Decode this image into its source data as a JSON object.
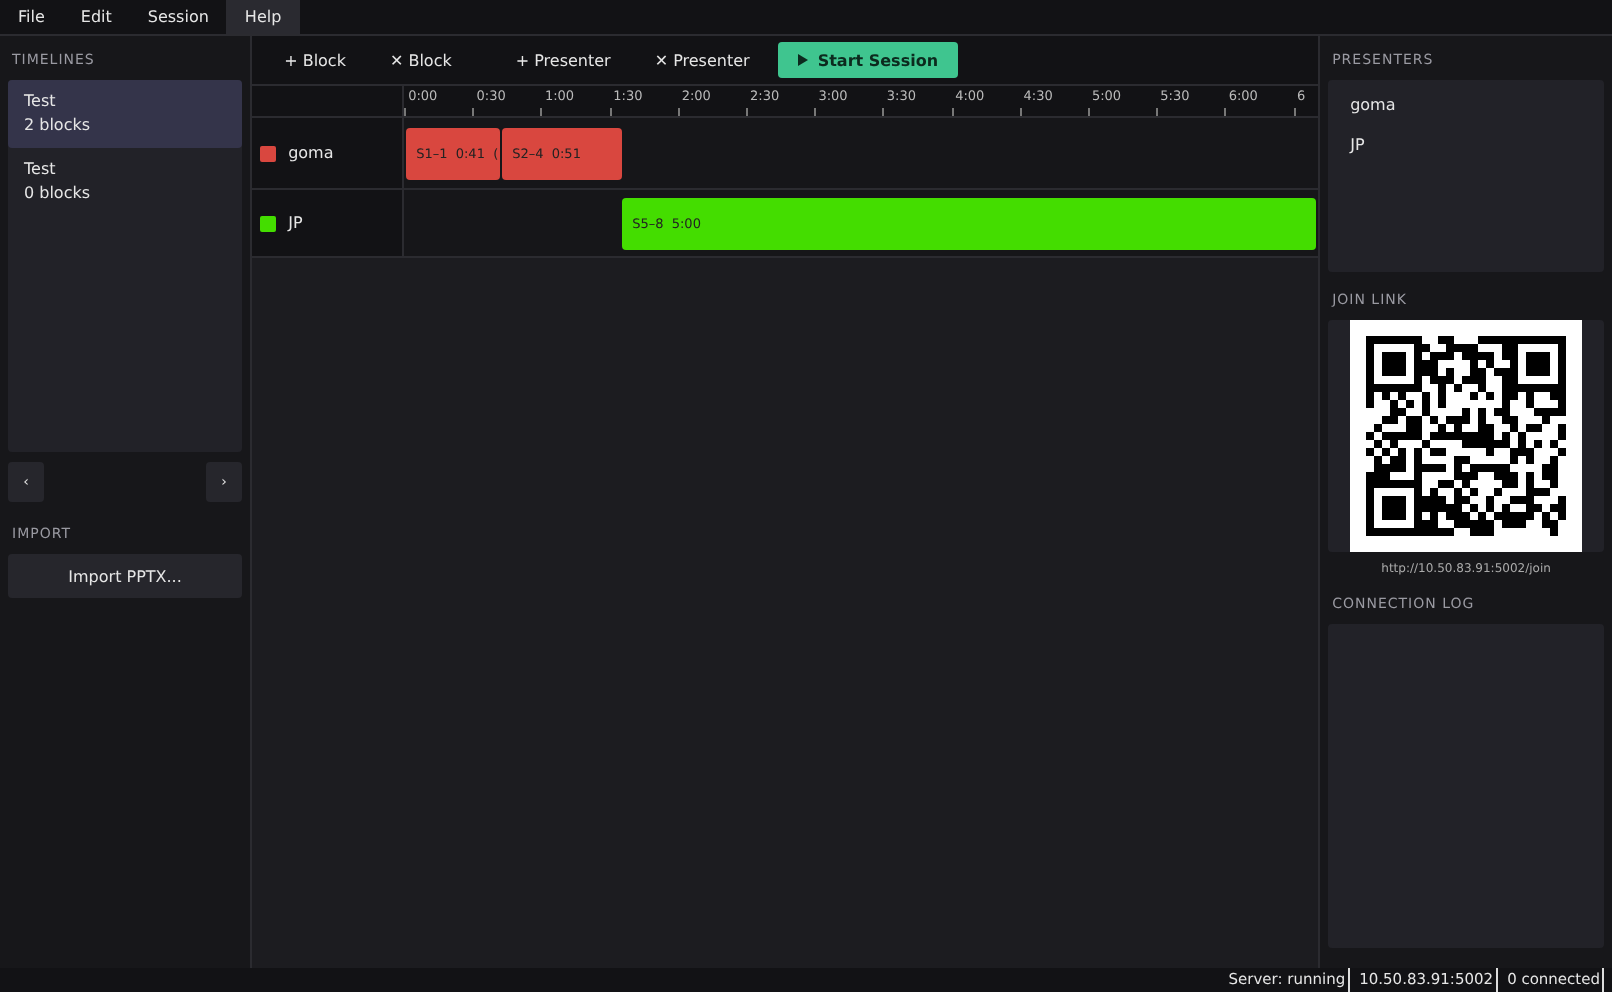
{
  "menu": [
    {
      "label": "File",
      "selected": false
    },
    {
      "label": "Edit",
      "selected": false
    },
    {
      "label": "Session",
      "selected": false
    },
    {
      "label": "Help",
      "selected": true
    }
  ],
  "timelines": {
    "title": "TIMELINES",
    "items": [
      {
        "name": "Test",
        "count": "2 blocks",
        "selected": true
      },
      {
        "name": "Test",
        "count": "0 blocks",
        "selected": false
      }
    ],
    "prev": "‹",
    "next": "›"
  },
  "import": {
    "title": "IMPORT",
    "button": "Import PPTX..."
  },
  "toolbar": {
    "buttons": [
      "+ Block",
      "✕ Block",
      "+ Presenter",
      "✕ Presenter"
    ],
    "start": "Start Session"
  },
  "ticks": [
    "0:00",
    "0:30",
    "1:00",
    "1:30",
    "2:00",
    "2:30",
    "3:00",
    "3:30",
    "4:00",
    "4:30",
    "5:00",
    "5:30",
    "6:00",
    "6"
  ],
  "tracks": [
    {
      "name": "goma",
      "color": "#d9473f",
      "blocks": [
        {
          "label": "S1–1  0:41  ("
        },
        {
          "label": "S2–4  0:51"
        }
      ]
    },
    {
      "name": "JP",
      "color": "#44dd00",
      "blocks": [
        {
          "label": "S5–8  5:00"
        }
      ]
    }
  ],
  "presenters": {
    "title": "PRESENTERS",
    "items": [
      "goma",
      "JP"
    ]
  },
  "join": {
    "title": "JOIN LINK",
    "url": "http://10.50.83.91:5002/join"
  },
  "log": {
    "title": "CONNECTION LOG"
  },
  "status": [
    "Server: running",
    "10.50.83.91:5002",
    "0 connected"
  ]
}
